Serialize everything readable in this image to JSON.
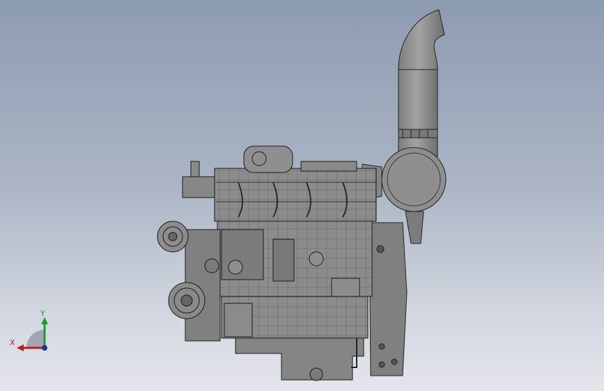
{
  "viewport": {
    "background_top": "#8d9bb1",
    "background_bottom": "#e4e6ec"
  },
  "model": {
    "icon": "engine-assembly-icon",
    "body_color": "#8a8a8a",
    "edge_color": "#1a1a1a"
  },
  "triad": {
    "x_label": "X",
    "y_label": "Y",
    "x_color": "#b81c1c",
    "y_color": "#1b9a2e",
    "z_color": "#1f2fa0"
  }
}
